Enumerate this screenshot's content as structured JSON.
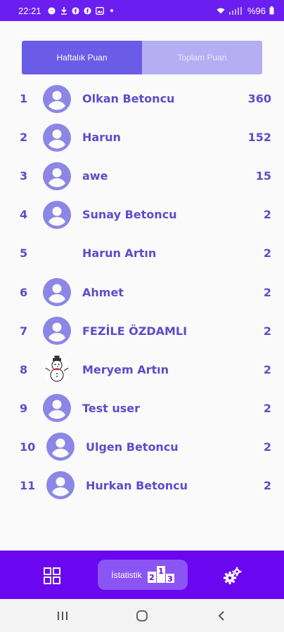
{
  "status_bar": {
    "time": "22:21",
    "battery": "%96"
  },
  "tabs": [
    {
      "label": "Haftalık Puan",
      "active": true
    },
    {
      "label": "Toplam Puan",
      "active": false
    }
  ],
  "leaderboard": [
    {
      "rank": "1",
      "name": "Olkan Betoncu",
      "score": "360",
      "avatar": "person-icon"
    },
    {
      "rank": "2",
      "name": "Harun",
      "score": "152",
      "avatar": "person-icon"
    },
    {
      "rank": "3",
      "name": "awe",
      "score": "15",
      "avatar": "person-icon"
    },
    {
      "rank": "4",
      "name": "Sunay Betoncu",
      "score": "2",
      "avatar": "person-icon"
    },
    {
      "rank": "5",
      "name": "Harun Artın",
      "score": "2",
      "avatar": "none"
    },
    {
      "rank": "6",
      "name": "Ahmet",
      "score": "2",
      "avatar": "person-icon"
    },
    {
      "rank": "7",
      "name": "FEZİLE ÖZDAMLI",
      "score": "2",
      "avatar": "person-icon"
    },
    {
      "rank": "8",
      "name": "Meryem Artın",
      "score": "2",
      "avatar": "photo-snowman"
    },
    {
      "rank": "9",
      "name": "Test user",
      "score": "2",
      "avatar": "person-icon"
    },
    {
      "rank": "10",
      "name": "Ulgen Betoncu",
      "score": "2",
      "avatar": "person-icon"
    },
    {
      "rank": "11",
      "name": "Hurkan Betoncu",
      "score": "2",
      "avatar": "person-icon"
    }
  ],
  "bottom_nav": {
    "stats_label": "İstatistik",
    "podium": [
      "2",
      "1",
      "3"
    ]
  },
  "colors": {
    "accent": "#5b4ec9",
    "avatar": "#8c86e6",
    "nav": "#6a06f0"
  }
}
